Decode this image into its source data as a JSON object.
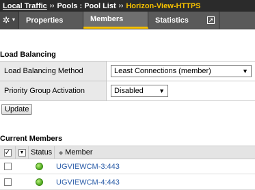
{
  "breadcrumb": {
    "root": "Local Traffic",
    "sep": "››",
    "middle": "Pools : Pool List",
    "current": "Horizon-View-HTTPS"
  },
  "tabs": [
    {
      "label": "Properties"
    },
    {
      "label": "Members"
    },
    {
      "label": "Statistics"
    }
  ],
  "load_balancing": {
    "title": "Load Balancing",
    "method_label": "Load Balancing Method",
    "method_value": "Least Connections (member)",
    "priority_label": "Priority Group Activation",
    "priority_value": "Disabled"
  },
  "update_label": "Update",
  "current_members": {
    "title": "Current Members",
    "columns": {
      "status": "Status",
      "member": "Member"
    },
    "rows": [
      {
        "member": "UGVIEWCM-3:443",
        "status": "green"
      },
      {
        "member": "UGVIEWCM-4:443",
        "status": "green"
      }
    ]
  },
  "colors": {
    "accent": "#f5c000",
    "link": "#2a5ca8",
    "status_ok": "#4aa51a"
  }
}
